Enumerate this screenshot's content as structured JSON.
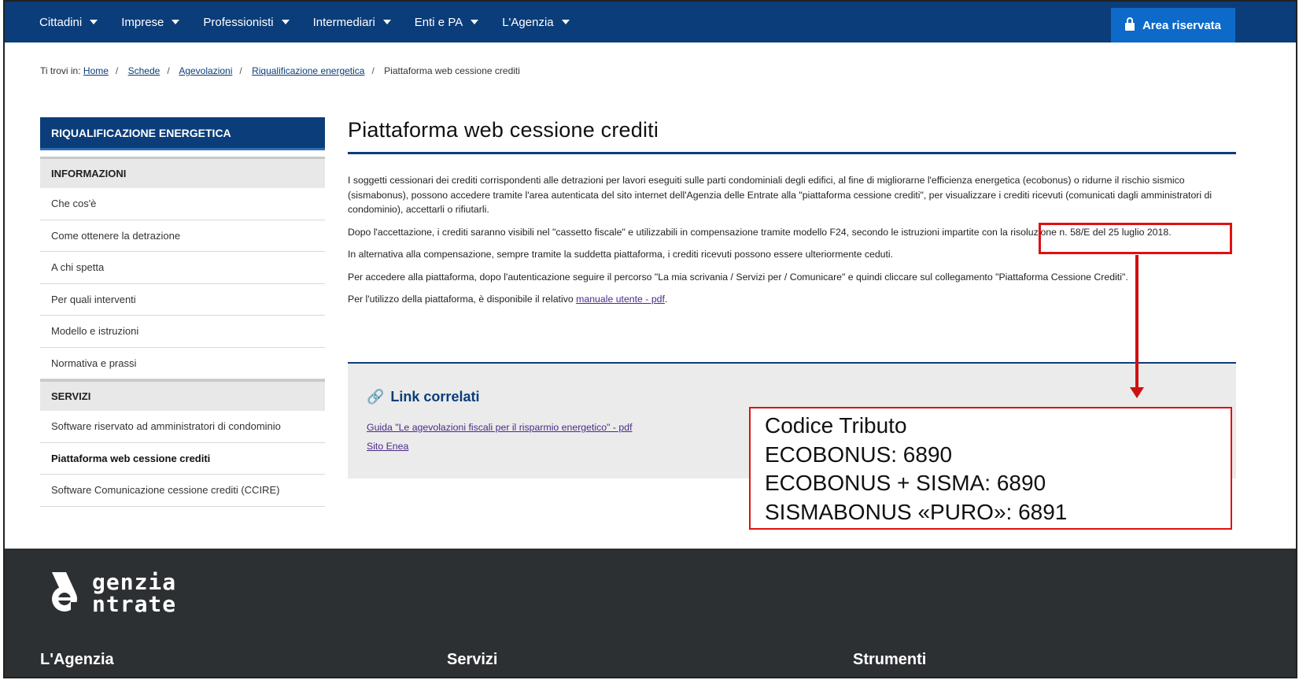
{
  "topnav": {
    "items": [
      "Cittadini",
      "Imprese",
      "Professionisti",
      "Intermediari",
      "Enti e PA",
      "L'Agenzia"
    ],
    "area_riservata": "Area riservata"
  },
  "breadcrumb": {
    "prefix": "Ti trovi in:",
    "links": [
      "Home",
      "Schede",
      "Agevolazioni",
      "Riqualificazione energetica"
    ],
    "current": "Piattaforma web cessione crediti"
  },
  "sidebar": {
    "heading": "RIQUALIFICAZIONE ENERGETICA",
    "section_info": "INFORMAZIONI",
    "info_items": [
      "Che cos'è",
      "Come ottenere la detrazione",
      "A chi spetta",
      "Per quali interventi",
      "Modello e istruzioni",
      "Normativa e prassi"
    ],
    "section_servizi": "SERVIZI",
    "servizi_items": [
      "Software riservato ad amministratori di condominio",
      "Piattaforma web cessione crediti",
      "Software Comunicazione cessione crediti (CCIRE)"
    ]
  },
  "main": {
    "title": "Piattaforma web cessione crediti",
    "p1": "I soggetti cessionari dei crediti corrispondenti alle detrazioni per lavori eseguiti sulle parti condominiali degli edifici, al fine di migliorarne l'efficienza energetica (ecobonus) o ridurne il rischio sismico (sismabonus), possono accedere tramite l'area autenticata del sito internet dell'Agenzia delle Entrate alla \"piattaforma cessione crediti\", per visualizzare i crediti ricevuti (comunicati dagli amministratori di condominio), accettarli o rifiutarli.",
    "p2": "Dopo l'accettazione, i crediti saranno visibili nel \"cassetto fiscale\" e utilizzabili in compensazione tramite modello F24, secondo le istruzioni impartite con la risoluzione n. 58/E del 25 luglio 2018.",
    "p3": "In alternativa alla compensazione, sempre tramite la suddetta piattaforma, i crediti ricevuti possono essere ulteriormente ceduti.",
    "p4": "Per accedere alla piattaforma, dopo l'autenticazione seguire il percorso \"La mia scrivania / Servizi per / Comunicare\" e quindi cliccare sul collegamento \"Piattaforma Cessione Crediti\".",
    "p5_text": "Per l'utilizzo della piattaforma, è disponibile il relativo",
    "p5_link": "manuale utente - pdf",
    "p5_end": "."
  },
  "related": {
    "title": "Link correlati",
    "links": [
      "Guida \"Le agevolazioni fiscali per il risparmio energetico\" - pdf",
      "Sito Enea"
    ]
  },
  "annotation": {
    "lines": [
      "Codice Tributo",
      "ECOBONUS: 6890",
      "ECOBONUS + SISMA: 6890",
      "SISMABONUS «PURO»: 6891"
    ],
    "highlight_color": "#e01010"
  },
  "footer": {
    "logo_line1": "genzia",
    "logo_line2": "ntrate",
    "columns": [
      "L'Agenzia",
      "Servizi",
      "Strumenti"
    ]
  },
  "colors": {
    "nav_bg": "#0b3d7a",
    "area_btn": "#0e6ac8",
    "footer_bg": "#2d3033"
  }
}
